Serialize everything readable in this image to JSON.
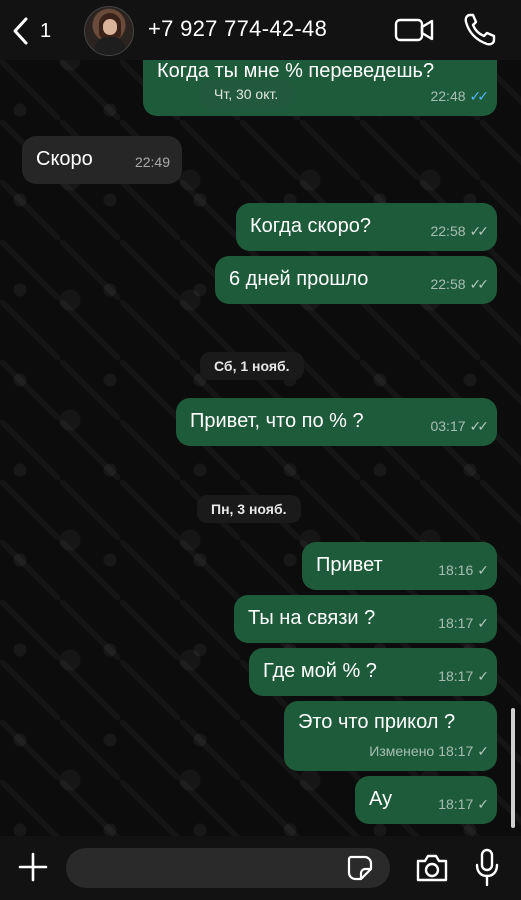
{
  "header": {
    "back_count": "1",
    "contact": "+7 927 774-42-48",
    "icons": {
      "back": "chevron-left-icon",
      "video": "video-camera-icon",
      "call": "phone-icon"
    }
  },
  "date_overlay": "Чт, 30 окт.",
  "messages": [
    {
      "dir": "out",
      "text": "Когда ты мне % переведешь?",
      "time": "22:48",
      "status": "read"
    },
    {
      "dir": "in",
      "text": "Скоро",
      "time": "22:49"
    },
    {
      "dir": "out",
      "text": "Когда скоро?",
      "time": "22:58",
      "status": "delivered"
    },
    {
      "dir": "out",
      "text": "6 дней прошло",
      "time": "22:58",
      "status": "delivered"
    },
    {
      "dir": "out",
      "text": "Привет, что по % ?",
      "time": "03:17",
      "status": "delivered"
    },
    {
      "dir": "out",
      "text": "Привет",
      "time": "18:16",
      "status": "sent"
    },
    {
      "dir": "out",
      "text": "Ты на связи ?",
      "time": "18:17",
      "status": "sent"
    },
    {
      "dir": "out",
      "text": "Где мой % ?",
      "time": "18:17",
      "status": "sent"
    },
    {
      "dir": "out",
      "text": "Это что прикол ?",
      "time": "18:17",
      "status": "sent",
      "edited": "Изменено"
    },
    {
      "dir": "out",
      "text": "Ау",
      "time": "18:17",
      "status": "sent"
    }
  ],
  "date_separators": [
    "Сб, 1 нояб.",
    "Пн, 3 нояб."
  ],
  "input_bar": {
    "placeholder": "",
    "icons": {
      "attach": "plus-icon",
      "sticker": "sticker-icon",
      "camera": "camera-icon",
      "mic": "microphone-icon"
    }
  },
  "colors": {
    "outgoing_bubble": "#1e5b3b",
    "incoming_bubble": "#262626",
    "read_check": "#4fb5ff",
    "background": "#0b0b0b"
  }
}
